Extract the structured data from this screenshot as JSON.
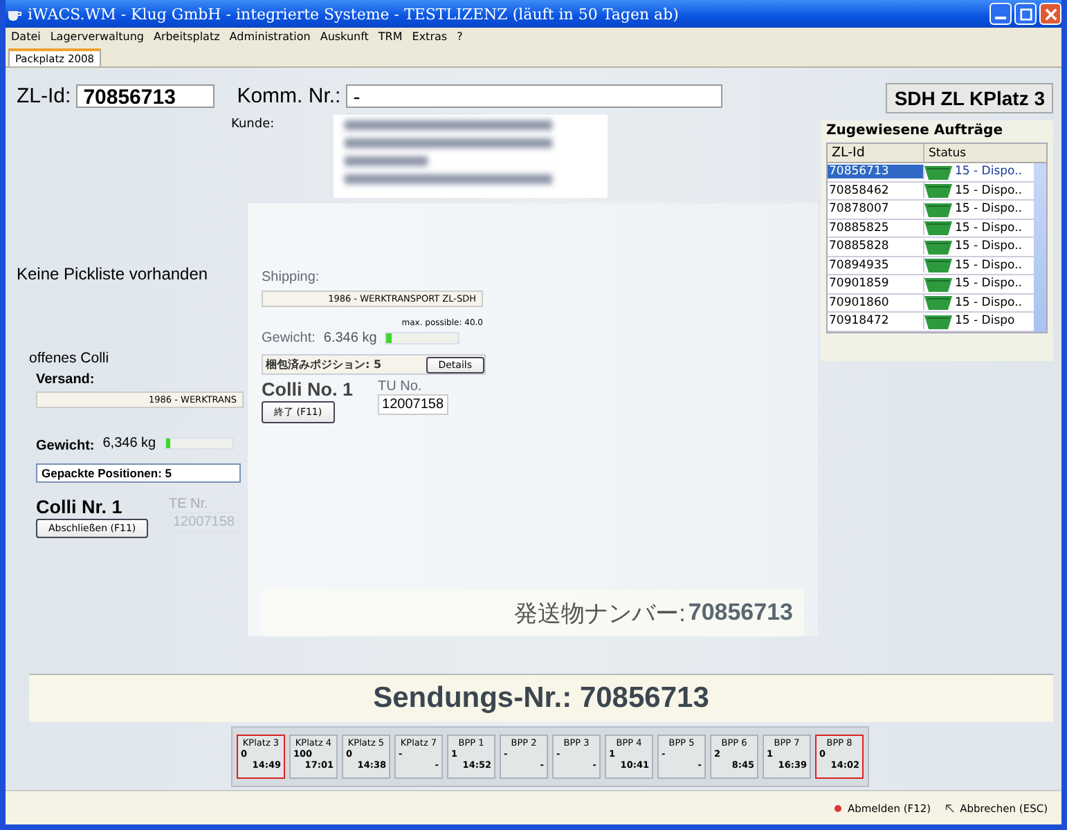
{
  "window": {
    "title": "iWACS.WM - Klug GmbH - integrierte Systeme - TESTLIZENZ (läuft in 50 Tagen ab)"
  },
  "menu": [
    "Datei",
    "Lagerverwaltung",
    "Arbeitsplatz",
    "Administration",
    "Auskunft",
    "TRM",
    "Extras",
    "?"
  ],
  "tabs": [
    {
      "label": "Packplatz 2008",
      "selected": true
    }
  ],
  "header": {
    "zl_id_label": "ZL-Id:",
    "zl_id": "70856713",
    "komm_label": "Komm. Nr.:",
    "komm": "-",
    "station": "SDH ZL KPlatz 3",
    "kunde_label": "Kunde:"
  },
  "orders": {
    "title": "Zugewiesene Aufträge",
    "columns": [
      "ZL-Id",
      "Status"
    ],
    "rows": [
      {
        "id": "70856713",
        "status": "15 - Dispo..",
        "selected": true
      },
      {
        "id": "70858462",
        "status": "15 - Dispo..",
        "selected": false
      },
      {
        "id": "70878007",
        "status": "15 - Dispo..",
        "selected": false
      },
      {
        "id": "70885825",
        "status": "15 - Dispo..",
        "selected": false
      },
      {
        "id": "70885828",
        "status": "15 - Dispo..",
        "selected": false
      },
      {
        "id": "70894935",
        "status": "15 - Dispo..",
        "selected": false
      },
      {
        "id": "70901859",
        "status": "15 - Dispo..",
        "selected": false
      },
      {
        "id": "70901860",
        "status": "15 - Dispo..",
        "selected": false
      },
      {
        "id": "70918472",
        "status": "15 - Dispo",
        "selected": false
      }
    ]
  },
  "german": {
    "no_picklist": "Keine Pickliste vorhanden",
    "open_colli": "offenes Colli",
    "versand_label": "Versand:",
    "versand": "1986 - WERKTRANS",
    "gewicht_label": "Gewicht:",
    "gewicht": "6,346 kg",
    "level": 0.08,
    "positions": "Gepackte Positionen: 5",
    "colli": "Colli Nr. 1",
    "close_button": "Abschließen (F11)",
    "te_label": "TE Nr.",
    "te": "12007158",
    "sendung": "Sendungs-Nr.: 70856713"
  },
  "japanese": {
    "shipping_label": "Shipping:",
    "shipping": "1986 - WERKTRANSPORT ZL-SDH",
    "max": "max. possible: 40.0",
    "gewicht_label": "Gewicht:",
    "gewicht": "6.346 kg",
    "level": 0.08,
    "positions": "梱包済みポジション: 5",
    "details": "Details",
    "colli": "Colli No. 1",
    "close_button": "終了 (F11)",
    "tu_label": "TU No.",
    "tu": "12007158",
    "number_label": "発送物ナンバー:",
    "number": "70856713"
  },
  "stations": [
    {
      "label": "KPlatz 3",
      "count": "0",
      "time": "14:49",
      "highlighted": true
    },
    {
      "label": "KPlatz 4",
      "count": "100",
      "time": "17:01",
      "highlighted": false
    },
    {
      "label": "KPlatz 5",
      "count": "0",
      "time": "14:38",
      "highlighted": false
    },
    {
      "label": "KPlatz 7",
      "count": "-",
      "time": "-",
      "highlighted": false
    },
    {
      "label": "BPP 1",
      "count": "1",
      "time": "14:52",
      "highlighted": false
    },
    {
      "label": "BPP 2",
      "count": "-",
      "time": "-",
      "highlighted": false
    },
    {
      "label": "BPP 3",
      "count": "-",
      "time": "-",
      "highlighted": false
    },
    {
      "label": "BPP 4",
      "count": "1",
      "time": "10:41",
      "highlighted": false
    },
    {
      "label": "BPP 5",
      "count": "-",
      "time": "-",
      "highlighted": false
    },
    {
      "label": "BPP 6",
      "count": "2",
      "time": "8:45",
      "highlighted": false
    },
    {
      "label": "BPP 7",
      "count": "1",
      "time": "16:39",
      "highlighted": false
    },
    {
      "label": "BPP 8",
      "count": "0",
      "time": "14:02",
      "highlighted": true
    }
  ],
  "footer": {
    "logout": "Abmelden (F12)",
    "cancel": "Abbrechen (ESC)"
  }
}
